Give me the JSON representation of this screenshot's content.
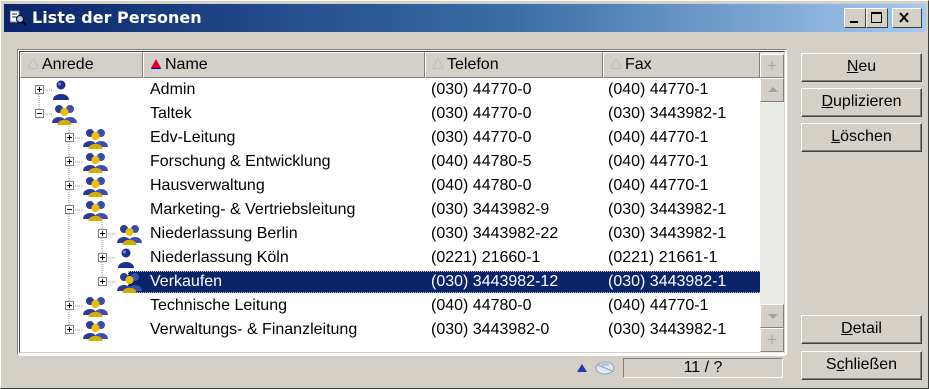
{
  "window": {
    "title": "Liste der Personen",
    "app_icon": "search-list-icon",
    "controls": [
      "minimize-icon",
      "maximize-icon",
      "close-icon"
    ]
  },
  "columns": [
    {
      "label": "Anrede",
      "sort": "none"
    },
    {
      "label": "Name",
      "sort": "ascending"
    },
    {
      "label": "Telefon",
      "sort": "none"
    },
    {
      "label": "Fax",
      "sort": "none"
    }
  ],
  "rows": [
    {
      "name": "Admin",
      "telefon": "(030) 44770-0",
      "fax": "(040) 44770-1",
      "level": 0,
      "expander": "plus",
      "icon": "person-icon",
      "selected": false
    },
    {
      "name": "Taltek",
      "telefon": "(030) 44770-0",
      "fax": "(030) 3443982-1",
      "level": 0,
      "expander": "minus",
      "icon": "group-icon",
      "selected": false
    },
    {
      "name": "Edv-Leitung",
      "telefon": "(030) 44770-0",
      "fax": "(040) 44770-1",
      "level": 1,
      "expander": "plus",
      "icon": "group-icon",
      "selected": false
    },
    {
      "name": "Forschung & Entwicklung",
      "telefon": "(040) 44780-5",
      "fax": "(040) 44770-1",
      "level": 1,
      "expander": "plus",
      "icon": "group-icon",
      "selected": false
    },
    {
      "name": "Hausverwaltung",
      "telefon": "(040) 44780-0",
      "fax": "(040) 44770-1",
      "level": 1,
      "expander": "plus",
      "icon": "group-icon",
      "selected": false
    },
    {
      "name": "Marketing- & Vertriebsleitung",
      "telefon": "(030) 3443982-9",
      "fax": "(030) 3443982-1",
      "level": 1,
      "expander": "minus",
      "icon": "group-icon",
      "selected": false
    },
    {
      "name": "Niederlassung Berlin",
      "telefon": "(030) 3443982-22",
      "fax": "(030) 3443982-1",
      "level": 2,
      "expander": "plus",
      "icon": "group-icon",
      "selected": false
    },
    {
      "name": "Niederlassung Köln",
      "telefon": "(0221) 21660-1",
      "fax": "(0221) 21661-1",
      "level": 2,
      "expander": "plus",
      "icon": "person-icon",
      "selected": false
    },
    {
      "name": "Verkaufen",
      "telefon": "(030) 3443982-12",
      "fax": "(030) 3443982-1",
      "level": 2,
      "expander": "plus",
      "icon": "group-icon",
      "selected": true
    },
    {
      "name": "Technische Leitung",
      "telefon": "(040) 44780-0",
      "fax": "(040) 44770-1",
      "level": 1,
      "expander": "plus",
      "icon": "group-icon",
      "selected": false
    },
    {
      "name": "Verwaltungs- & Finanzleitung",
      "telefon": "(030) 3443982-0",
      "fax": "(030) 3443982-1",
      "level": 1,
      "expander": "plus",
      "icon": "group-icon",
      "selected": false
    }
  ],
  "status": {
    "counter": "11 / ?",
    "icons": [
      "sort-up-icon",
      "filter-icon"
    ]
  },
  "buttons": {
    "neu": {
      "mnemonic": "N",
      "rest": "eu"
    },
    "duplizieren": {
      "mnemonic": "D",
      "rest": "uplizieren"
    },
    "loeschen": {
      "mnemonic": "L",
      "rest": "öschen"
    },
    "detail": {
      "mnemonic": "D",
      "rest": "etail"
    },
    "schliessen": {
      "pre": "S",
      "mnemonic": "c",
      "rest": "hließen"
    }
  },
  "colors": {
    "selection": "#0a246a",
    "title_start": "#0a246a",
    "title_end": "#a6caf0",
    "window_bg": "#d4d0c8"
  }
}
